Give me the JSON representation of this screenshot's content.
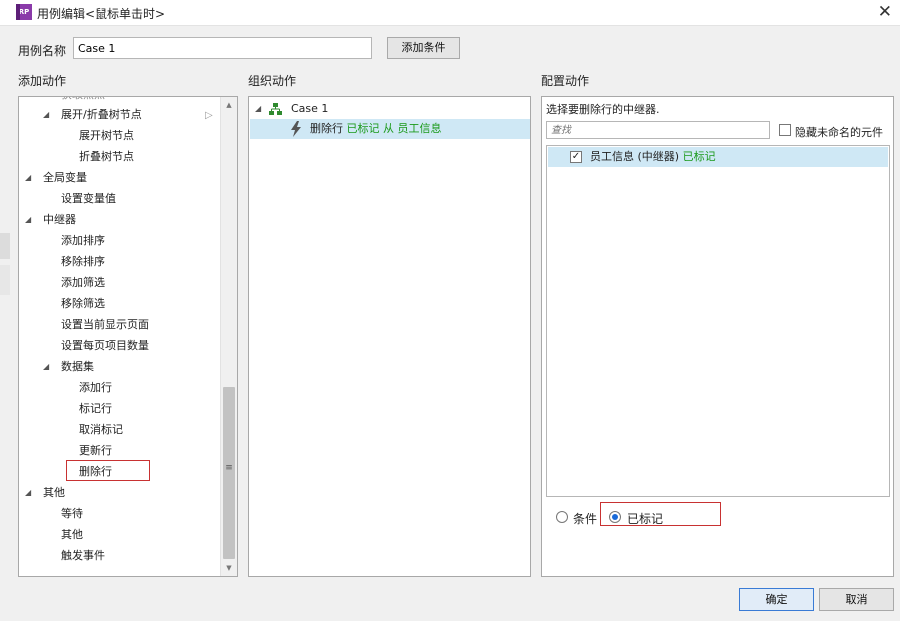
{
  "window": {
    "title": "用例编辑<鼠标单击时>",
    "app_icon": "RP"
  },
  "case_name": {
    "label": "用例名称",
    "value": "Case 1",
    "add_condition": "添加条件"
  },
  "sections": {
    "add_action": "添加动作",
    "organize_action": "组织动作",
    "configure_action": "配置动作"
  },
  "left_tree": {
    "partial_top": "获取焦点",
    "expand_collapse": "展开/折叠树节点",
    "expand_node": "展开树节点",
    "collapse_node": "折叠树节点",
    "global_var": "全局变量",
    "set_var": "设置变量值",
    "repeater": "中继器",
    "add_sort": "添加排序",
    "remove_sort": "移除排序",
    "add_filter": "添加筛选",
    "remove_filter": "移除筛选",
    "set_page": "设置当前显示页面",
    "set_items_per_page": "设置每页项目数量",
    "dataset": "数据集",
    "add_row": "添加行",
    "mark_row": "标记行",
    "unmark": "取消标记",
    "update_row": "更新行",
    "delete_row": "删除行",
    "other_group": "其他",
    "wait": "等待",
    "other_item": "其他",
    "fire_event": "触发事件"
  },
  "organize": {
    "case_label": "Case 1",
    "action_verb": "删除行",
    "action_marked": "已标记",
    "action_from": "从",
    "action_target": "员工信息"
  },
  "configure": {
    "prompt": "选择要删除行的中继器.",
    "search_placeholder": "查找",
    "hide_unnamed": "隐藏未命名的元件",
    "repeater_item": "员工信息 (中继器)",
    "repeater_marked": "已标记",
    "radio_condition": "条件",
    "radio_marked": "已标记"
  },
  "buttons": {
    "ok": "确定",
    "cancel": "取消"
  },
  "colors": {
    "selection": "#cfe8f5",
    "green": "#1b9a1b",
    "highlight": "#c83232"
  }
}
